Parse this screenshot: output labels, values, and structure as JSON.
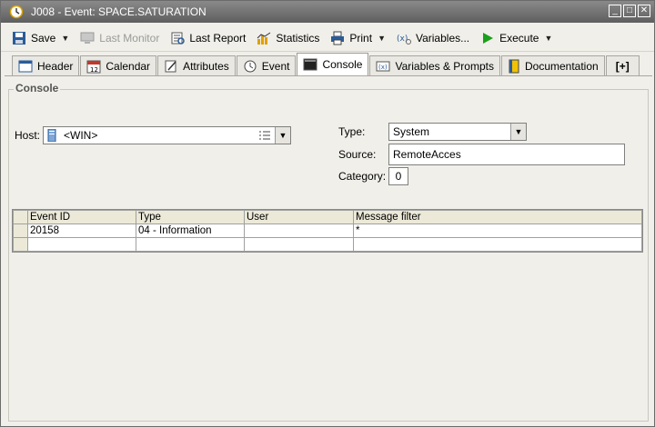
{
  "window": {
    "title": "J008 - Event: SPACE.SATURATION",
    "minimize_glyph": "_",
    "maximize_glyph": "□",
    "close_glyph": "✕"
  },
  "toolbar": {
    "save": "Save",
    "last_monitor": "Last Monitor",
    "last_report": "Last Report",
    "statistics": "Statistics",
    "print": "Print",
    "variables": "Variables...",
    "execute": "Execute"
  },
  "tabs": {
    "header": "Header",
    "calendar": "Calendar",
    "attributes": "Attributes",
    "event": "Event",
    "console": "Console",
    "variables_prompts": "Variables & Prompts",
    "documentation": "Documentation",
    "add": "[+]"
  },
  "console": {
    "group_title": "Console",
    "host_label": "Host:",
    "host_value": "<WIN>",
    "type_label": "Type:",
    "type_value": "System",
    "source_label": "Source:",
    "source_value": "RemoteAcces",
    "category_label": "Category:",
    "category_value": "0"
  },
  "table": {
    "columns": [
      "Event ID",
      "Type",
      "User",
      "Message filter"
    ],
    "rows": [
      [
        "20158",
        "04 - Information",
        "",
        "*"
      ],
      [
        "",
        "",
        "",
        ""
      ]
    ]
  },
  "colors": {
    "titlebar": "#6e6e6e",
    "execute_green": "#1aa01a"
  }
}
